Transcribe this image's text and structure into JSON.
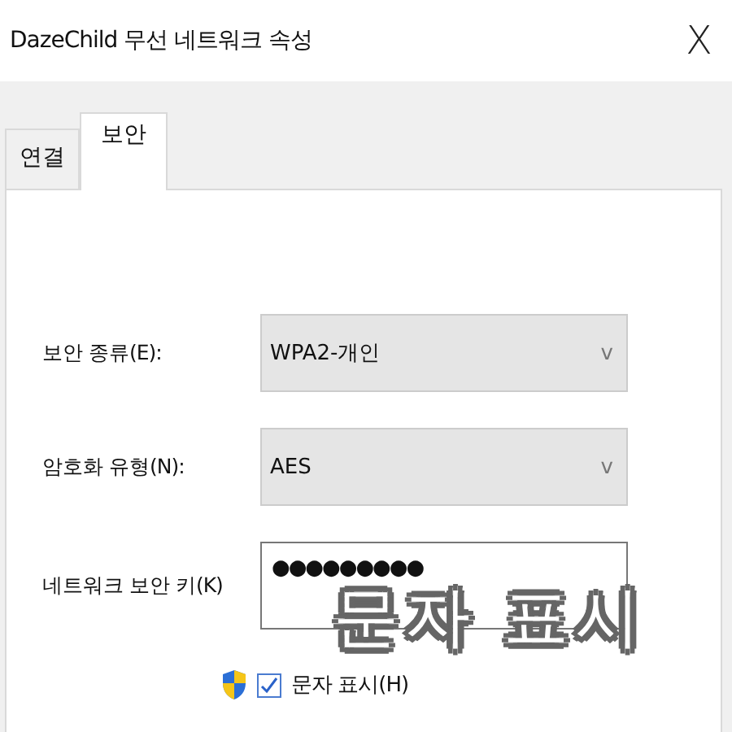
{
  "window": {
    "title": "DazeChild 무선 네트워크 속성",
    "close": "X"
  },
  "tabs": [
    {
      "label": "연결",
      "selected": false
    },
    {
      "label": "보안",
      "selected": true
    }
  ],
  "fields": [
    {
      "kind": "combo",
      "label": "보안 종류(E):",
      "value": "WPA2-개인",
      "arrow": "v"
    },
    {
      "kind": "combo",
      "label": "암호화 유형(N):",
      "value": "AES",
      "arrow": "v"
    },
    {
      "kind": "password",
      "label": "네트워크 보안 키(K)",
      "value": "●●●●●●●●●"
    }
  ],
  "show_characters": {
    "label": "문자 표시(H)",
    "checked": true
  },
  "overlay_caption": "문자 표시"
}
